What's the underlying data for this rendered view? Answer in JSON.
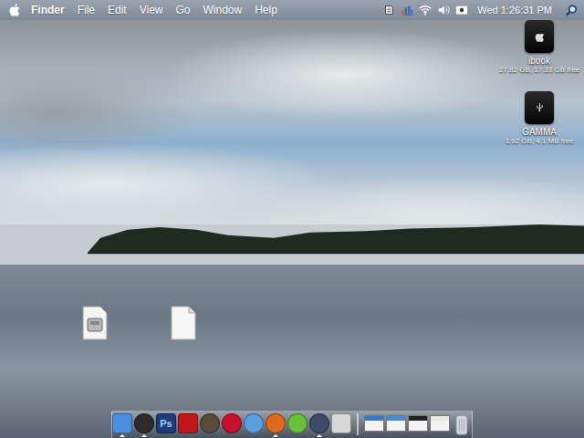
{
  "menubar": {
    "menus": [
      {
        "label": "Finder",
        "bold": true
      },
      {
        "label": "File",
        "bold": false
      },
      {
        "label": "Edit",
        "bold": false
      },
      {
        "label": "View",
        "bold": false
      },
      {
        "label": "Go",
        "bold": false
      },
      {
        "label": "Window",
        "bold": false
      },
      {
        "label": "Help",
        "bold": false
      }
    ],
    "clock": "Wed 1:26:31 PM"
  },
  "drives": [
    {
      "name": "ibook",
      "info": "27.82 GB, 17.33 GB free",
      "kind": "internal"
    },
    {
      "name": "GAMMA",
      "info": "1.92 GB, 4.1 MB free",
      "kind": "usb"
    }
  ],
  "files": [
    {
      "kind": "disk-image"
    },
    {
      "kind": "document"
    }
  ],
  "dock": {
    "apps": [
      {
        "kind": "square",
        "label": "",
        "color": "#4a8fe0",
        "running": true
      },
      {
        "kind": "circle",
        "label": "",
        "color": "#2b2b2b",
        "running": true
      },
      {
        "kind": "square",
        "label": "Ps",
        "color": "#1f3a7a",
        "running": false
      },
      {
        "kind": "square",
        "label": "",
        "color": "#c0171b",
        "running": false
      },
      {
        "kind": "circle",
        "label": "",
        "color": "#5a4a3a",
        "running": false
      },
      {
        "kind": "circle",
        "label": "",
        "color": "#c8102e",
        "running": false
      },
      {
        "kind": "circle",
        "label": "",
        "color": "#5aa0e0",
        "running": false
      },
      {
        "kind": "circle",
        "label": "",
        "color": "#e06a1c",
        "running": true
      },
      {
        "kind": "circle",
        "label": "",
        "color": "#6abf3a",
        "running": false
      },
      {
        "kind": "circle",
        "label": "",
        "color": "#3b4a6b",
        "running": true
      },
      {
        "kind": "square",
        "label": "",
        "color": "#d8d8d8",
        "running": false
      }
    ],
    "windows": [
      {
        "color": "#3a78c8"
      },
      {
        "color": "#4b8ad6"
      },
      {
        "color": "#222222"
      },
      {
        "color": "#e8e8e8"
      }
    ]
  }
}
